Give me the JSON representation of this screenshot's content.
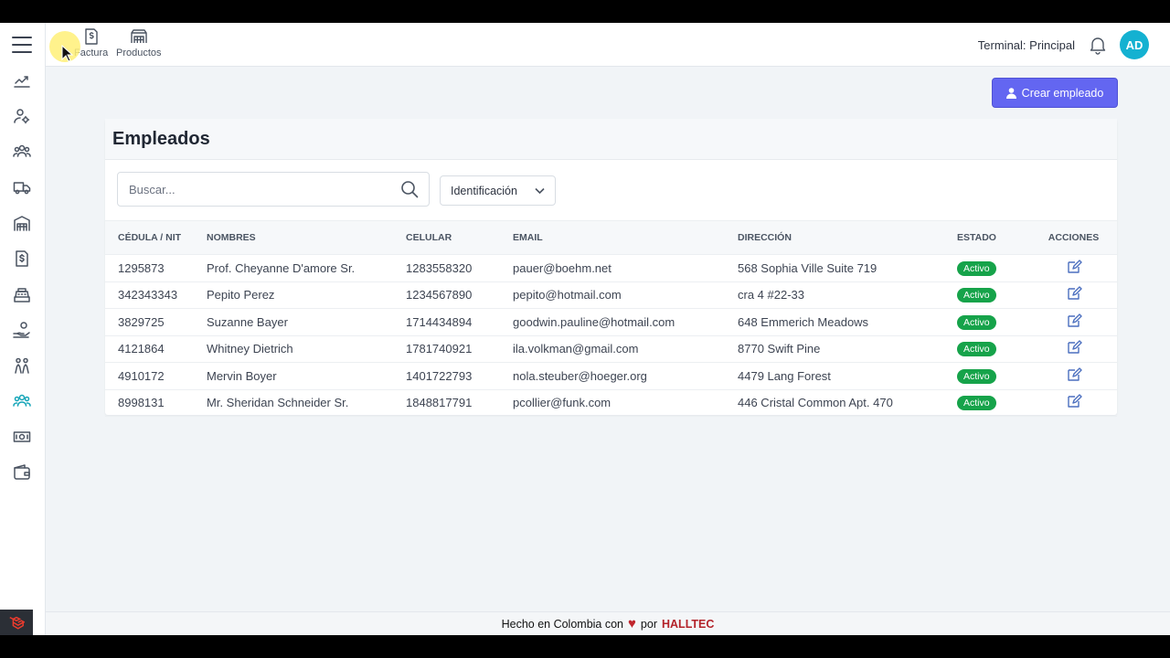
{
  "topbar": {
    "shortcuts": [
      {
        "label": "Factura",
        "icon": "invoice-icon"
      },
      {
        "label": "Productos",
        "icon": "warehouse-icon"
      }
    ],
    "terminal": "Terminal: Principal",
    "avatar_initials": "AD"
  },
  "sidebar": {
    "items": [
      {
        "icon": "chart-line-icon"
      },
      {
        "icon": "user-settings-icon"
      },
      {
        "icon": "users-group-icon"
      },
      {
        "icon": "truck-icon"
      },
      {
        "icon": "warehouse-icon"
      },
      {
        "icon": "invoice-icon"
      },
      {
        "icon": "cash-register-icon"
      },
      {
        "icon": "hand-coin-icon"
      },
      {
        "icon": "people-icon"
      },
      {
        "icon": "employees-icon",
        "active": true
      },
      {
        "icon": "money-icon"
      },
      {
        "icon": "wallet-icon"
      }
    ]
  },
  "actions": {
    "create_label": "Crear empleado"
  },
  "card": {
    "title": "Empleados",
    "search_placeholder": "Buscar...",
    "filter_selected": "Identificación"
  },
  "table": {
    "headers": {
      "cedula": "CÉDULA / NIT",
      "nombres": "NOMBRES",
      "celular": "CELULAR",
      "email": "EMAIL",
      "direccion": "DIRECCIÓN",
      "estado": "ESTADO",
      "acciones": "ACCIONES"
    },
    "rows": [
      {
        "cedula": "1295873",
        "nombres": "Prof. Cheyanne D'amore Sr.",
        "celular": "1283558320",
        "email": "pauer@boehm.net",
        "direccion": "568 Sophia Ville Suite 719",
        "estado": "Activo"
      },
      {
        "cedula": "342343343",
        "nombres": "Pepito Perez",
        "celular": "1234567890",
        "email": "pepito@hotmail.com",
        "direccion": "cra 4 #22-33",
        "estado": "Activo"
      },
      {
        "cedula": "3829725",
        "nombres": "Suzanne Bayer",
        "celular": "1714434894",
        "email": "goodwin.pauline@hotmail.com",
        "direccion": "648 Emmerich Meadows",
        "estado": "Activo"
      },
      {
        "cedula": "4121864",
        "nombres": "Whitney Dietrich",
        "celular": "1781740921",
        "email": "ila.volkman@gmail.com",
        "direccion": "8770 Swift Pine",
        "estado": "Activo"
      },
      {
        "cedula": "4910172",
        "nombres": "Mervin Boyer",
        "celular": "1401722793",
        "email": "nola.steuber@hoeger.org",
        "direccion": "4479 Lang Forest",
        "estado": "Activo"
      },
      {
        "cedula": "8998131",
        "nombres": "Mr. Sheridan Schneider Sr.",
        "celular": "1848817791",
        "email": "pcollier@funk.com",
        "direccion": "446 Cristal Common Apt. 470",
        "estado": "Activo"
      }
    ]
  },
  "footer": {
    "text": "Hecho en Colombia con",
    "by": "por",
    "brand": "HALLTEC"
  },
  "colors": {
    "primary": "#6366f1",
    "active_badge": "#16a34a",
    "avatar": "#14b1d1",
    "active_icon": "#16a5b8",
    "brand": "#b3232a"
  }
}
